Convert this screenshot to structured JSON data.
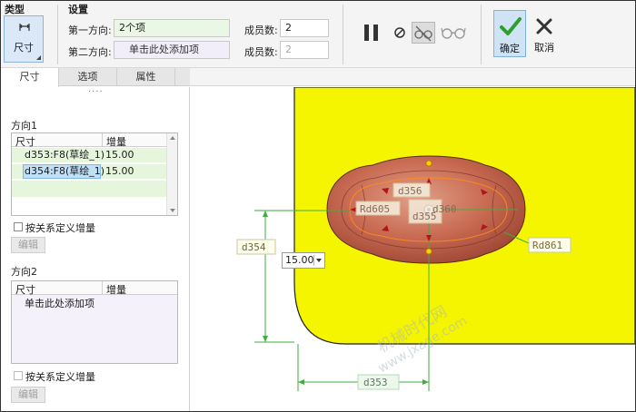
{
  "ribbon": {
    "type_group": {
      "title": "类型",
      "dimension_button": "尺寸"
    },
    "settings_group": {
      "title": "设置",
      "direction1_label": "第一方向:",
      "direction1_value": "2个项",
      "direction2_label": "第二方向:",
      "direction2_value": "单击此处添加项",
      "member_count_label": "成员数:",
      "member_count1": "2",
      "member_count2": "2"
    },
    "ok_label": "确定",
    "cancel_label": "取消"
  },
  "tabs": [
    "尺寸",
    "选项",
    "属性"
  ],
  "panel": {
    "direction1": {
      "title": "方向1",
      "columns": [
        "尺寸",
        "增量"
      ],
      "rows": [
        {
          "dim": "d353:F8(草绘_1)",
          "inc": "15.00"
        },
        {
          "dim": "d354:F8(草绘_1)",
          "inc": "15.00"
        }
      ],
      "relation_checkbox": "按关系定义增量",
      "edit_button": "编辑"
    },
    "direction2": {
      "title": "方向2",
      "columns": [
        "尺寸",
        "增量"
      ],
      "placeholder_row": "单击此处添加项",
      "relation_checkbox": "按关系定义增量",
      "edit_button": "编辑"
    }
  },
  "viewport": {
    "dimensions": {
      "d354": "d354",
      "d353": "d353",
      "d356": "d356",
      "rd605": "Rd605",
      "rd861": "Rd861",
      "d355": "d355",
      "d360": "d360"
    },
    "value_editor": "15.00",
    "watermark_line1": "机械时代网",
    "watermark_line2": "www.jxage.com"
  },
  "colors": {
    "part_yellow": "#f5f500",
    "boss_fill": "#c96a52",
    "dimension_green": "#3fae3f",
    "selection_bg": "#bfe0f7",
    "row_green": "#e6f6dc"
  },
  "icons": [
    "dimension-icon",
    "pause-icon",
    "no-preview-icon",
    "glasses-off-icon",
    "glasses-icon",
    "check-icon",
    "close-icon"
  ]
}
